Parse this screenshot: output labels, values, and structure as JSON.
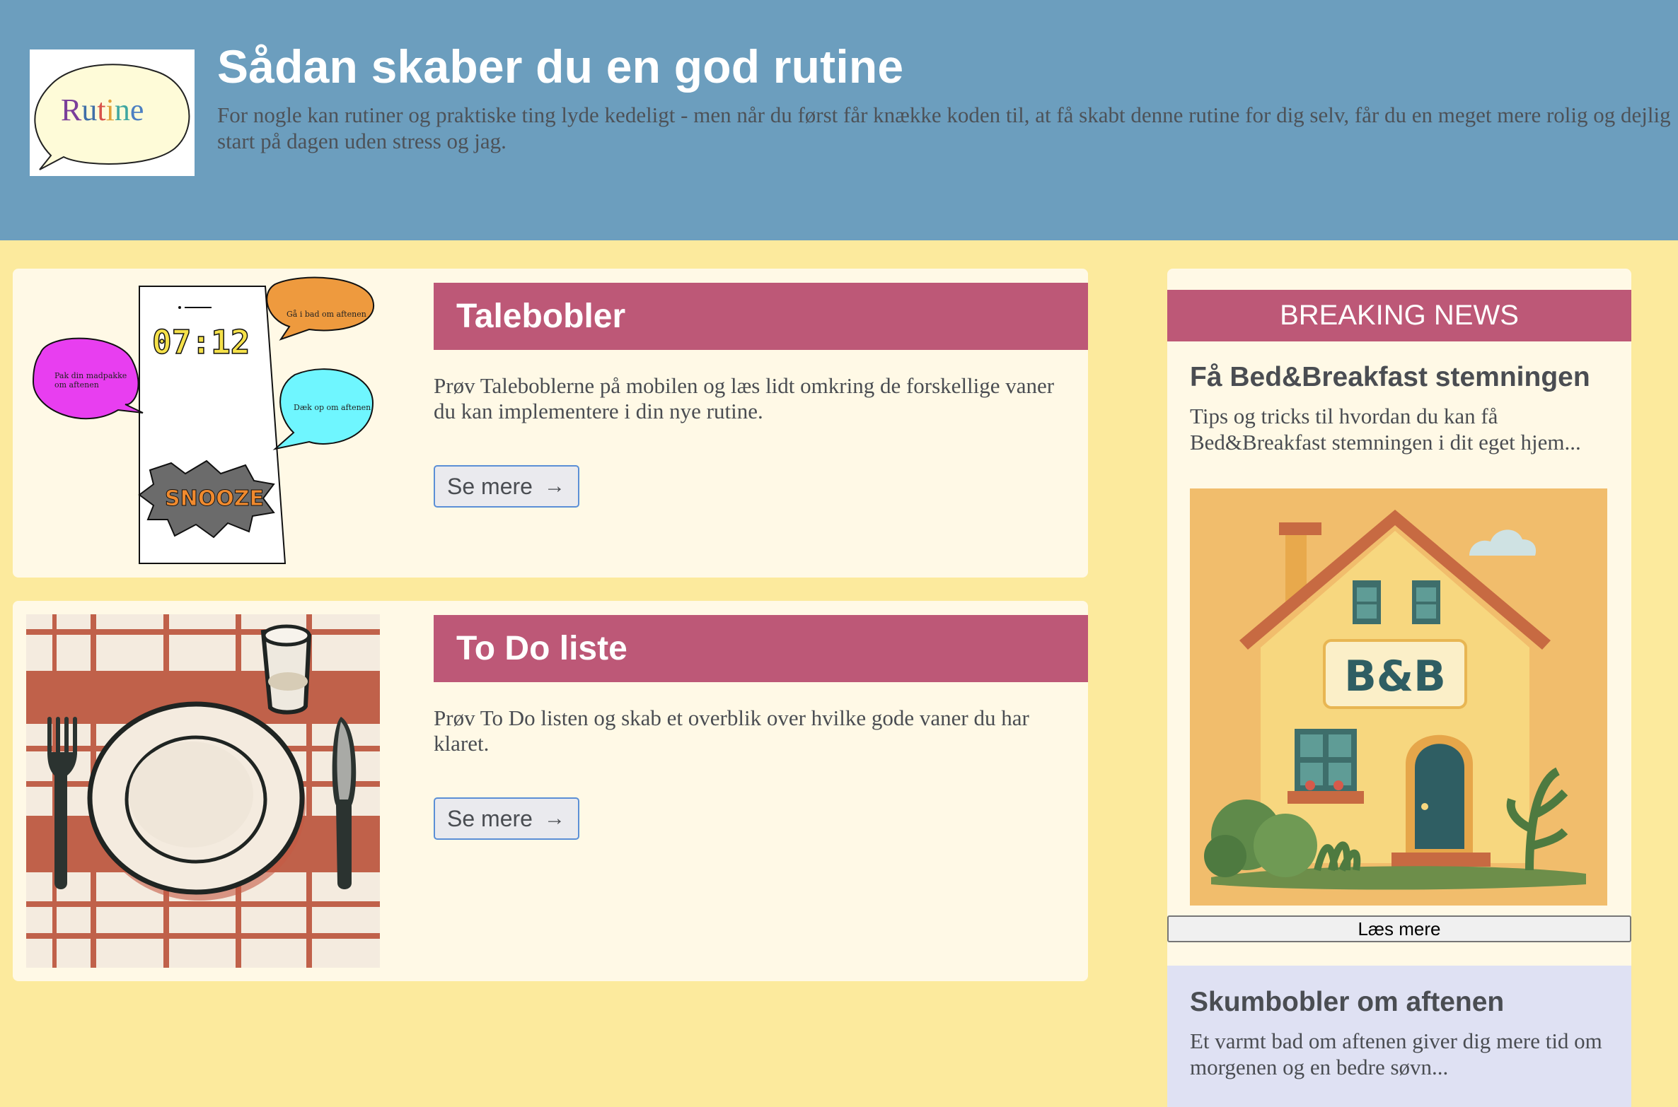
{
  "header": {
    "logo_text": "Rutine",
    "title": "Sådan skaber du en god rutine",
    "intro": "For nogle kan rutiner og praktiske ting lyde kedeligt - men når du først får knække koden til, at få skabt denne rutine for dig selv, får du en meget mere rolig og dejlig start på dagen uden stress og jag."
  },
  "cards": [
    {
      "heading": "Talebobler",
      "text": "Prøv Taleboblerne på mobilen og læs lidt omkring de forskellige vaner du kan implementere i din nye rutine.",
      "button_label": "Se mere",
      "button_arrow": "→",
      "illustration": {
        "clock": "07:12",
        "bubble_left": "Pak din madpakke om aftenen",
        "bubble_top_right": "Gå i bad om aftenen",
        "bubble_mid_right": "Dæk op om aftenen",
        "burst": "SNOOZE"
      }
    },
    {
      "heading": "To Do liste",
      "text": "Prøv To Do listen og skab et overblik over hvilke gode vaner du har klaret.",
      "button_label": "Se mere",
      "button_arrow": "→"
    }
  ],
  "sidebar": {
    "banner": "BREAKING NEWS",
    "news": {
      "title": "Få Bed&Breakfast stemningen",
      "text": "Tips og tricks til hvordan du kan få Bed&Breakfast stemningen i dit eget hjem...",
      "sign": "B&B",
      "button_label": "Læs mere"
    },
    "news2": {
      "title": "Skumbobler om aftenen",
      "text": "Et varmt bad om aftenen giver dig mere tid om morgenen og en bedre søvn..."
    }
  },
  "colors": {
    "header_bg": "#6c9ebe",
    "page_bg": "#fcea9d",
    "card_bg": "#fff9e6",
    "accent": "#bd5877",
    "news2_bg": "#dfe1f3"
  }
}
